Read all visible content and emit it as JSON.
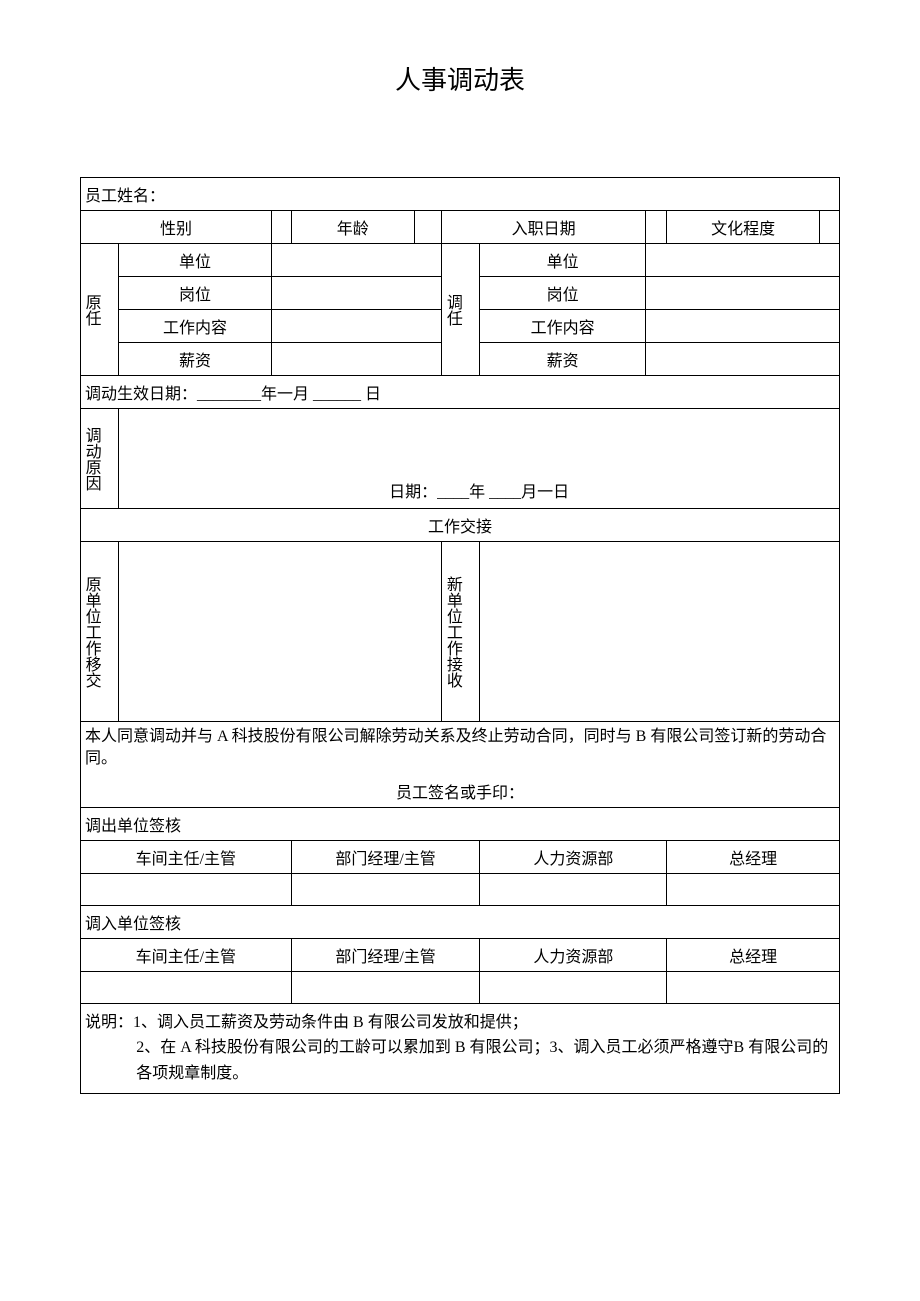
{
  "title": "人事调动表",
  "rows": {
    "name_label": "员工姓名：",
    "gender_label": "性别",
    "age_label": "年龄",
    "hire_date_label": "入职日期",
    "education_label": "文化程度",
    "original_label": "原任",
    "new_label": "调任",
    "unit_label": "单位",
    "position_label": "岗位",
    "work_content_label": "工作内容",
    "salary_label": "薪资",
    "effective_date": "调动生效日期：________年一月 ______ 日",
    "reason_label": "调动原因",
    "reason_date": "日期：____年 ____月一日",
    "handover_header": "工作交接",
    "orig_handover_label": "原单位工作移交",
    "new_handover_label": "新单位工作接收",
    "consent_text": "本人同意调动并与 A 科技股份有限公司解除劳动关系及终止劳动合同，同时与 B 有限公司签订新的劳动合同。",
    "signature_label": "员工签名或手印：",
    "out_approval_header": "调出单位签核",
    "in_approval_header": "调入单位签核",
    "approver1": "车间主任/主管",
    "approver2": "部门经理/主管",
    "approver3": "人力资源部",
    "approver4": "总经理",
    "notes_prefix": "说明：",
    "note1": "1、调入员工薪资及劳动条件由 B 有限公司发放和提供；",
    "note2": "2、在 A 科技股份有限公司的工龄可以累加到 B 有限公司；3、调入员工必须严格遵守B 有限公司的各项规章制度。"
  }
}
